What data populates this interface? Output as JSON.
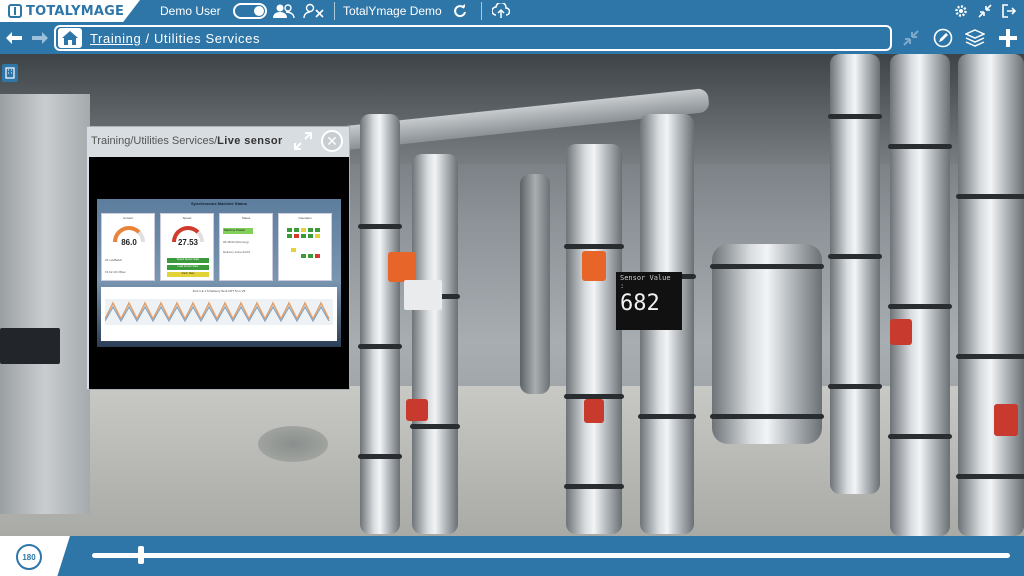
{
  "app": {
    "logo_text": "TOTALYMAGE",
    "user_name": "Demo User",
    "project_name": "TotalYmage Demo"
  },
  "nav": {
    "breadcrumb_link": "Training",
    "breadcrumb_separator": " / ",
    "breadcrumb_current": "Utilities Services"
  },
  "popup": {
    "path_prefix": "Training/Utilities Services/",
    "path_current": "Live sensor",
    "close_glyph": "✕"
  },
  "dashboard": {
    "title": "Synchronous Machine Status",
    "cards": [
      {
        "title": "Current",
        "value": "86.0",
        "note1": "26 mA/Batch",
        "note2": "15.02.19  Offset"
      },
      {
        "title": "Speed",
        "value": "27.53",
        "bar1": "Speed Sensor State",
        "bar2": "Load Sensor State",
        "bar3": "Alarm State"
      },
      {
        "title": "Status",
        "status": "Machine Plastic",
        "note1": "02:48:00  (Running)",
        "note2": "Delivery since 04:02"
      },
      {
        "title": "Operation"
      }
    ],
    "trend_title": "SLS 1 E 1 5 Delivery Sent NXT 5 L1 V5"
  },
  "sensor": {
    "label": "Sensor Value :",
    "value": "682"
  },
  "bottom": {
    "view_mode_label": "180",
    "timeline_progress": 0.05
  },
  "colors": {
    "brand": "#2e76a8",
    "valve_orange": "#e8652a",
    "valve_red": "#c83a2e"
  }
}
